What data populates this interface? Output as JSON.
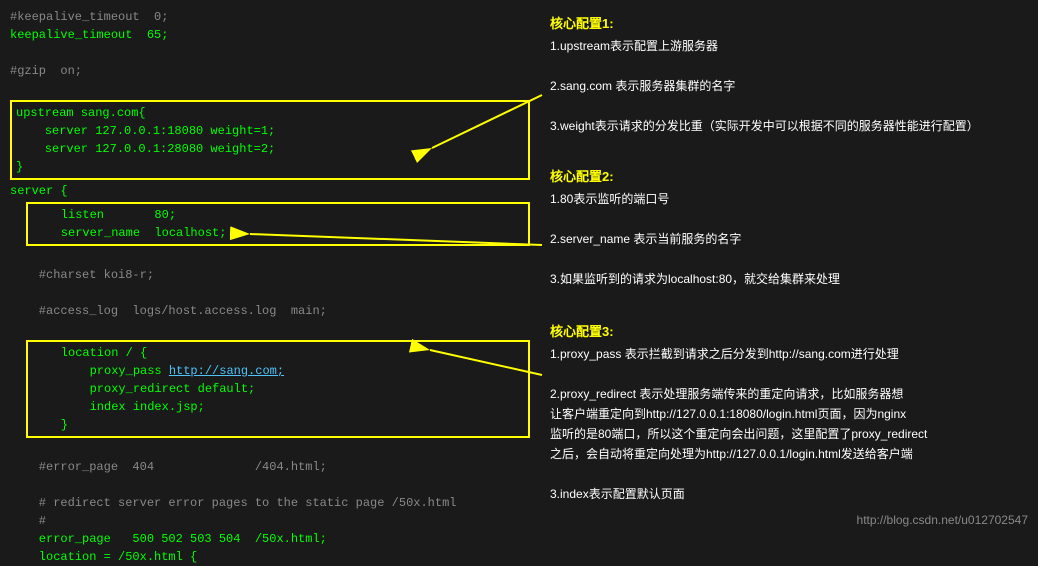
{
  "code": {
    "lines": [
      {
        "text": "#keepalive_timeout  0;",
        "style": "gray"
      },
      {
        "text": "keepalive_timeout  65;",
        "style": "green"
      },
      {
        "text": "",
        "style": "green"
      },
      {
        "text": "#gzip  on;",
        "style": "gray"
      },
      {
        "text": "",
        "style": "green"
      },
      {
        "text": "upstream sang.com{",
        "style": "green",
        "boxed": "upstream-start"
      },
      {
        "text": "    server 127.0.0.1:18080 weight=1;",
        "style": "green",
        "boxed": "upstream-mid"
      },
      {
        "text": "    server 127.0.0.1:28080 weight=2;",
        "style": "green",
        "boxed": "upstream-mid"
      },
      {
        "text": "}",
        "style": "green",
        "boxed": "upstream-end"
      },
      {
        "text": "server {",
        "style": "green"
      },
      {
        "text": "    listen       80;",
        "style": "green",
        "boxed": "server-start"
      },
      {
        "text": "    server_name  localhost;",
        "style": "green",
        "boxed": "server-end"
      },
      {
        "text": "",
        "style": "green"
      },
      {
        "text": "    #charset koi8-r;",
        "style": "gray"
      },
      {
        "text": "",
        "style": "green"
      },
      {
        "text": "    #access_log  logs/host.access.log  main;",
        "style": "gray"
      },
      {
        "text": "",
        "style": "green"
      },
      {
        "text": "    location / {",
        "style": "green",
        "boxed": "location-start"
      },
      {
        "text": "        proxy_pass http://sang.com;",
        "style": "green",
        "boxed": "location-mid",
        "hasLink": true
      },
      {
        "text": "        proxy_redirect default;",
        "style": "green",
        "boxed": "location-mid"
      },
      {
        "text": "        index index.jsp;",
        "style": "green",
        "boxed": "location-mid"
      },
      {
        "text": "    }",
        "style": "green",
        "boxed": "location-end"
      },
      {
        "text": "",
        "style": "green"
      },
      {
        "text": "    #error_page  404              /404.html;",
        "style": "gray"
      },
      {
        "text": "",
        "style": "green"
      },
      {
        "text": "    # redirect server error pages to the static page /50x.html",
        "style": "gray"
      },
      {
        "text": "    #",
        "style": "gray"
      },
      {
        "text": "    error_page   500 502 503 504  /50x.html;",
        "style": "green"
      },
      {
        "text": "    location = /50x.html {",
        "style": "green"
      }
    ]
  },
  "annotations": {
    "block1": {
      "title": "核心配置1:",
      "items": [
        "1.upstream表示配置上游服务器",
        "2.sang.com 表示服务器集群的名字",
        "3.weight表示请求的分发比重（实际开发中可以根据不同的服务器性能进行配置）"
      ]
    },
    "block2": {
      "title": "核心配置2:",
      "items": [
        "1.80表示监听的端口号",
        "2.server_name 表示当前服务的名字",
        "3.如果监听到的请求为localhost:80，就交给集群来处理"
      ]
    },
    "block3": {
      "title": "核心配置3:",
      "items": [
        "1.proxy_pass 表示拦截到请求之后分发到http://sang.com进行处理",
        "2.proxy_redirect 表示处理服务端传来的重定向请求，比如服务器想让客户端重定向到http://127.0.0.1:18080/login.html页面，因为nginx监听的是80端口，所以这个重定向会出问题，这里配置了proxy_redirect之后，会自动将重定向处理为http://127.0.0.1/login.html发送给客户端",
        "3.index表示配置默认页面"
      ]
    }
  },
  "watermark": "http://blog.csdn.net/u012702547"
}
